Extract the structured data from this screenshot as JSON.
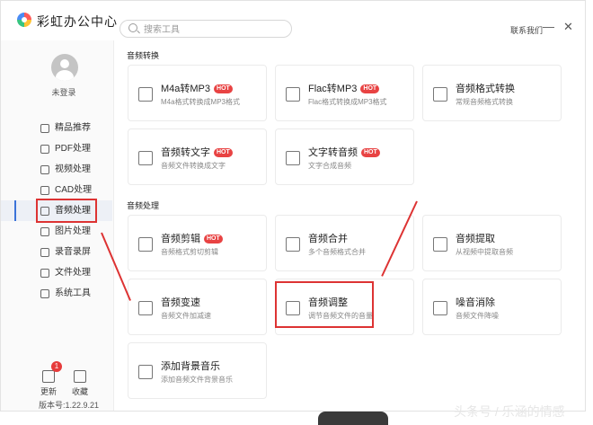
{
  "app": {
    "title": "彩虹办公中心"
  },
  "search": {
    "placeholder": "搜索工具"
  },
  "header": {
    "contact": "联系我们",
    "minimize": "—",
    "close": "✕"
  },
  "user": {
    "login": "未登录"
  },
  "sidebar": {
    "items": [
      {
        "label": "精品推荐",
        "icon": "thumb-up-icon"
      },
      {
        "label": "PDF处理",
        "icon": "pdf-icon"
      },
      {
        "label": "视频处理",
        "icon": "video-icon"
      },
      {
        "label": "CAD处理",
        "icon": "cad-icon"
      },
      {
        "label": "音频处理",
        "icon": "music-note-icon",
        "active": true
      },
      {
        "label": "图片处理",
        "icon": "image-icon"
      },
      {
        "label": "录音录屏",
        "icon": "record-icon"
      },
      {
        "label": "文件处理",
        "icon": "folder-icon"
      },
      {
        "label": "系统工具",
        "icon": "monitor-icon"
      }
    ]
  },
  "bottom": {
    "update": "更新",
    "update_badge": "1",
    "favorite": "收藏",
    "version": "版本号:1.22.9.21"
  },
  "sections": {
    "conversion": "音频转换",
    "processing": "音频处理"
  },
  "cards": [
    {
      "title": "M4a转MP3",
      "hot": "HOT",
      "sub": "M4a格式转换成MP3格式"
    },
    {
      "title": "Flac转MP3",
      "hot": "HOT",
      "sub": "Flac格式转换成MP3格式"
    },
    {
      "title": "音频格式转换",
      "sub": "常规音频格式转换"
    },
    {
      "title": "音频转文字",
      "hot": "HOT",
      "sub": "音频文件转换成文字"
    },
    {
      "title": "文字转音频",
      "hot": "HOT",
      "sub": "文字合成音频"
    },
    {
      "title": "音频剪辑",
      "hot": "HOT",
      "sub": "音频格式剪切剪辑"
    },
    {
      "title": "音频合并",
      "sub": "多个音频格式合并"
    },
    {
      "title": "音频提取",
      "sub": "从视频中提取音频"
    },
    {
      "title": "音频变速",
      "sub": "音频文件加减速"
    },
    {
      "title": "音频调整",
      "sub": "调节音频文件的音量"
    },
    {
      "title": "噪音消除",
      "sub": "音频文件降噪"
    },
    {
      "title": "添加背景音乐",
      "sub": "添加音频文件背景音乐"
    }
  ],
  "watermark": "头条号 / 乐涵的情感"
}
